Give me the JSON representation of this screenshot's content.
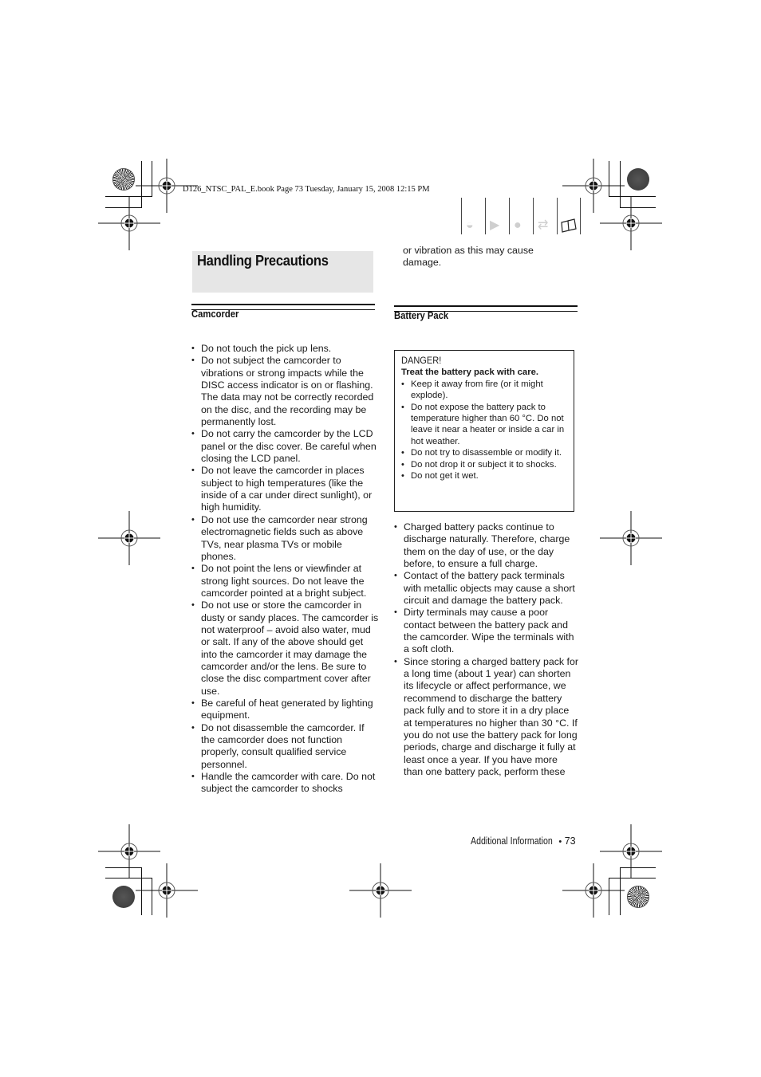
{
  "print_header": {
    "book_info": "D126_NTSC_PAL_E.book  Page 73  Tuesday, January 15, 2008  12:15 PM"
  },
  "icon_strip": [
    {
      "icon": "camcorder-recording-icon",
      "glyph": "◒",
      "active": false
    },
    {
      "icon": "movie-camera-icon",
      "glyph": "▶",
      "active": false
    },
    {
      "icon": "camera-photo-icon",
      "glyph": "●",
      "active": false
    },
    {
      "icon": "transfer-arrows-icon",
      "glyph": "⇄",
      "active": false
    },
    {
      "icon": "open-book-icon",
      "glyph": "🕮",
      "active": true
    }
  ],
  "page_title": "Handling Precautions",
  "left_column": {
    "section_title": "Camcorder",
    "items": [
      "Do not touch the pick up lens.",
      "Do not subject the camcorder to vibrations or strong impacts while the DISC access indicator is on or flashing. The data may not be correctly recorded on the disc, and the recording may be permanently lost.",
      "Do not carry the camcorder by the LCD panel or the disc cover. Be careful when closing the LCD panel.",
      "Do not leave the camcorder in places subject to high temperatures (like the inside of a car under direct sunlight), or high humidity.",
      "Do not use the camcorder near strong electromagnetic fields such as above TVs, near plasma TVs or mobile phones.",
      "Do not point the lens or viewfinder at strong light sources. Do not leave the camcorder pointed at a bright subject.",
      "Do not use or store the camcorder in dusty or sandy places. The camcorder is not waterproof – avoid also water, mud or salt. If any of the above should get into the camcorder it may damage the camcorder and/or the lens. Be sure to close the disc compartment cover after use.",
      "Be careful of heat generated by lighting equipment.",
      "Do not disassemble the camcorder. If the camcorder does not function properly, consult qualified service personnel.",
      "Handle the camcorder with care. Do not subject the camcorder to shocks"
    ]
  },
  "right_column": {
    "continuation": "or vibration as this may cause damage.",
    "section_title": "Battery Pack",
    "danger_box": {
      "title": "DANGER!",
      "subtitle": "Treat the battery pack with care.",
      "items": [
        "Keep it away from fire (or it might explode).",
        "Do not expose the battery pack to temperature higher than 60 °C. Do not leave it near a heater or inside a car in hot weather.",
        "Do not try to disassemble or modify it.",
        "Do not drop it or subject it to shocks.",
        "Do not get it wet."
      ]
    },
    "items": [
      "Charged battery packs continue to discharge naturally. Therefore, charge them on the day of use, or the day before, to ensure a full charge.",
      "Contact of the battery pack terminals with metallic objects may cause a short circuit and damage the battery pack.",
      "Dirty terminals may cause a poor contact between the battery pack and the camcorder. Wipe the terminals with a soft cloth.",
      "Since storing a charged battery pack for a long time (about 1 year) can shorten its lifecycle or affect performance, we recommend to discharge the battery pack fully and to store it in a dry place at temperatures no higher than 30 °C. If you do not use the battery pack for long periods, charge and discharge it fully at least once a year. If you have more than one battery pack, perform these"
    ]
  },
  "footer": {
    "section": "Additional Information",
    "separator": "•",
    "page_number": "73"
  }
}
